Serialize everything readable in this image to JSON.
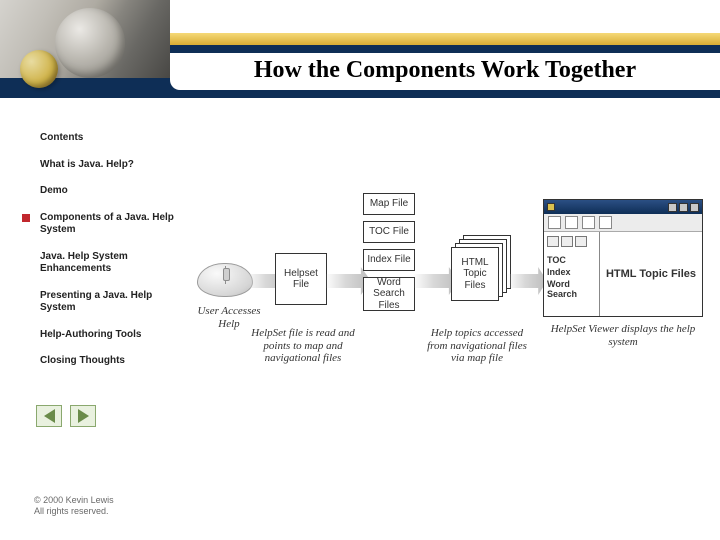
{
  "slide": {
    "title": "How the Components Work Together"
  },
  "sidebar": {
    "items": [
      {
        "label": "Contents"
      },
      {
        "label": "What is Java. Help?"
      },
      {
        "label": "Demo"
      },
      {
        "label": "Components of a Java. Help System"
      },
      {
        "label": "Java. Help System Enhancements"
      },
      {
        "label": "Presenting a Java. Help System"
      },
      {
        "label": "Help-Authoring Tools"
      },
      {
        "label": "Closing Thoughts"
      }
    ],
    "active_index": 3
  },
  "diagram": {
    "mouse_caption": "User Accesses Help",
    "helpset_box": "Helpset\nFile",
    "helpset_caption": "HelpSet file is read and points to map and navigational files",
    "nav_boxes": [
      "Map File",
      "TOC File",
      "Index File",
      "Word Search Files"
    ],
    "html_box": "HTML\nTopic Files",
    "html_caption": "Help topics accessed from navigational files via map file",
    "viewer": {
      "window_title": "",
      "nav_entries": [
        "TOC",
        "Index",
        "Word Search"
      ],
      "topic_label": "HTML Topic Files"
    },
    "viewer_caption": "HelpSet Viewer displays the help system"
  },
  "footer": {
    "line1": "© 2000 Kevin Lewis",
    "line2": "All rights reserved."
  }
}
